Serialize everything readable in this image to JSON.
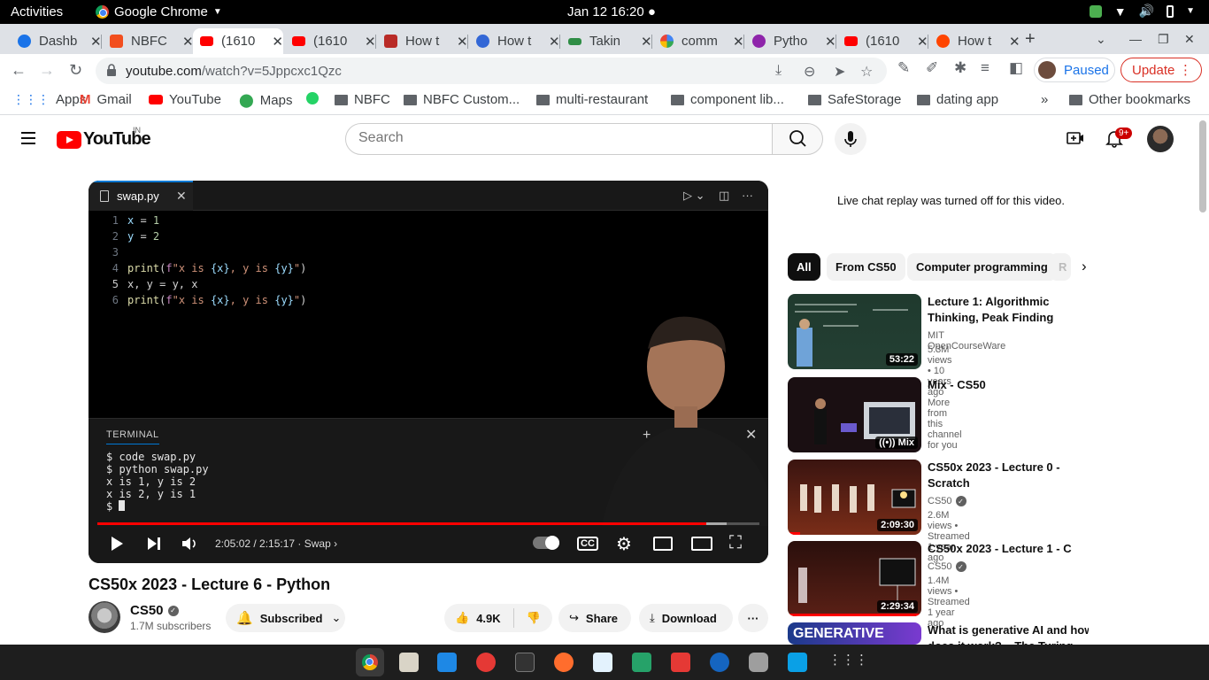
{
  "system": {
    "activities": "Activities",
    "app_name": "Google Chrome",
    "clock": "Jan 12  16:20"
  },
  "tabs": [
    {
      "title": "Dashb",
      "color": "#1a73e8"
    },
    {
      "title": "NBFC",
      "color": "#f24e1e"
    },
    {
      "title": "(1610",
      "color": "#ff0000"
    },
    {
      "title": "(1610",
      "color": "#ff0000"
    },
    {
      "title": "How t",
      "color": "#b92b27"
    },
    {
      "title": "How t",
      "color": "#3367d6"
    },
    {
      "title": "Takin",
      "color": "#2f8d46"
    },
    {
      "title": "comm",
      "color": "#4285f4"
    },
    {
      "title": "Pytho",
      "color": "#8e24aa"
    },
    {
      "title": "(1610",
      "color": "#ff0000"
    },
    {
      "title": "How t",
      "color": "#ff4500"
    }
  ],
  "toolbar": {
    "url_host": "youtube.com",
    "url_path": "/watch?v=5Jppcxc1Qzc",
    "paused_label": "Paused",
    "update_label": "Update"
  },
  "bookmarks": {
    "apps": "Apps",
    "gmail": "Gmail",
    "youtube": "YouTube",
    "maps": "Maps",
    "nbfc": "NBFC",
    "nbfc_custom": "NBFC Custom...",
    "multi_restaurant": "multi-restaurant",
    "component_lib": "component lib...",
    "safestorage": "SafeStorage",
    "dating_app": "dating app",
    "overflow": "»",
    "other": "Other bookmarks"
  },
  "youtube": {
    "logo": "YouTube",
    "region": "IN",
    "search_placeholder": "Search",
    "notif_count": "9+"
  },
  "player": {
    "editor_tab": "swap.py",
    "code": {
      "n1": "1",
      "n2": "2",
      "n3": "3",
      "n4": "4",
      "n5": "5",
      "n6": "6"
    },
    "terminal_title": "TERMINAL",
    "terminal_lines": "$ code swap.py\n$ python swap.py\nx is 1, y is 2\nx is 2, y is 1\n$ ",
    "time": "2:05:02 / 2:15:17",
    "chapter": "Swap",
    "progress_fraction": 0.92,
    "buffered_fraction": 0.95
  },
  "video": {
    "title": "CS50x 2023 - Lecture 6 - Python",
    "channel": "CS50",
    "subscribers": "1.7M subscribers",
    "subscribed_label": "Subscribed",
    "likes": "4.9K",
    "share_label": "Share",
    "download_label": "Download"
  },
  "sidebar": {
    "chat_off": "Live chat replay was turned off for this video.",
    "chips": [
      "All",
      "From CS50",
      "Computer programming",
      "R"
    ],
    "recs": [
      {
        "title": "Lecture 1: Algorithmic Thinking, Peak Finding",
        "channel": "MIT OpenCourseWare",
        "meta": "5.3M views • 10 years ago",
        "duration": "53:22"
      },
      {
        "title": "Mix - CS50",
        "channel": "More from this channel for you",
        "meta": "",
        "duration": "Mix"
      },
      {
        "title": "CS50x 2023 - Lecture 0 - Scratch",
        "channel": "CS50",
        "meta": "2.6M views • Streamed 1 year ago",
        "duration": "2:09:30"
      },
      {
        "title": "CS50x 2023 - Lecture 1 - C",
        "channel": "CS50",
        "meta": "1.4M views • Streamed 1 year ago",
        "duration": "2:29:34"
      },
      {
        "title": "What is generative AI and how does it work? – The Turing",
        "thumb_text": "GENERATIVE"
      }
    ]
  }
}
